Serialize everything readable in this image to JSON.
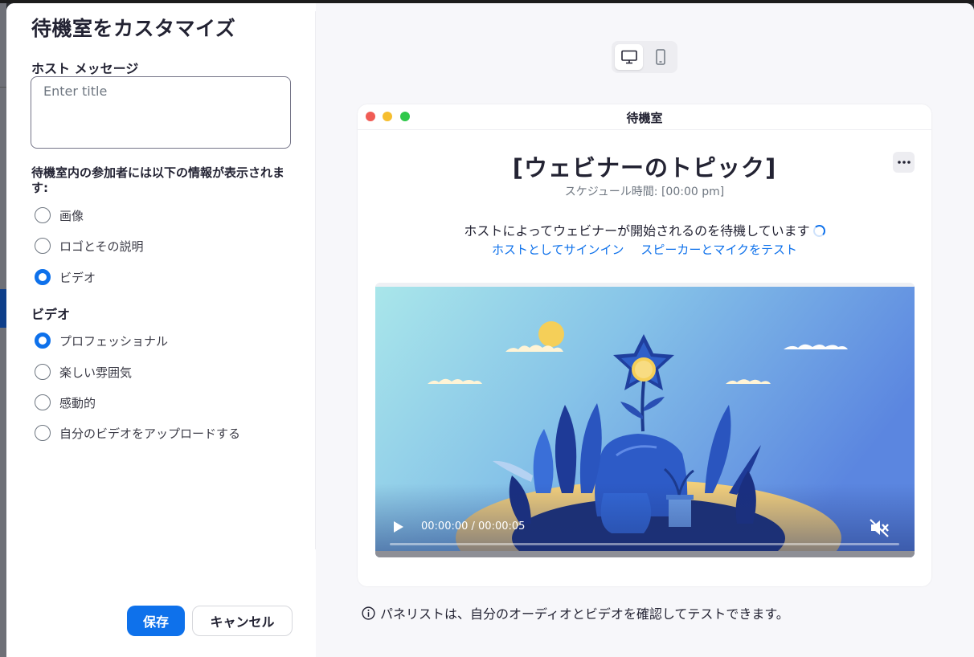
{
  "left_panel": {
    "title": "待機室をカスタマイズ",
    "host_message_label": "ホスト メッセージ",
    "host_message_placeholder": "Enter title",
    "info_label": "待機室内の参加者には以下の情報が表示されます:",
    "display_options": [
      {
        "label": "画像",
        "selected": false
      },
      {
        "label": "ロゴとその説明",
        "selected": false
      },
      {
        "label": "ビデオ",
        "selected": true
      }
    ],
    "video_label": "ビデオ",
    "video_options": [
      {
        "label": "プロフェッショナル",
        "selected": true
      },
      {
        "label": "楽しい雰囲気",
        "selected": false
      },
      {
        "label": "感動的",
        "selected": false
      },
      {
        "label": "自分のビデオをアップロードする",
        "selected": false
      }
    ],
    "save_label": "保存",
    "cancel_label": "キャンセル"
  },
  "preview": {
    "view_toggle": {
      "active": "desktop",
      "options": [
        "desktop-icon",
        "mobile-icon"
      ]
    },
    "window_title": "待機室",
    "topic": "[ウェビナーのトピック]",
    "schedule": "スケジュール時間: [00:00 pm]",
    "waiting_text": "ホストによってウェビナーが開始されるのを待機しています",
    "link_signin": "ホストとしてサインイン",
    "link_test": "スピーカーとマイクをテスト",
    "video_time": "00:00:00 / 00:00:05",
    "video_progress": 0,
    "muted": true
  },
  "note": "パネリストは、自分のオーディオとビデオを確認してテストできます。",
  "colors": {
    "accent": "#0e71eb",
    "text": "#232333",
    "panel_bg": "#f7f7fa"
  }
}
